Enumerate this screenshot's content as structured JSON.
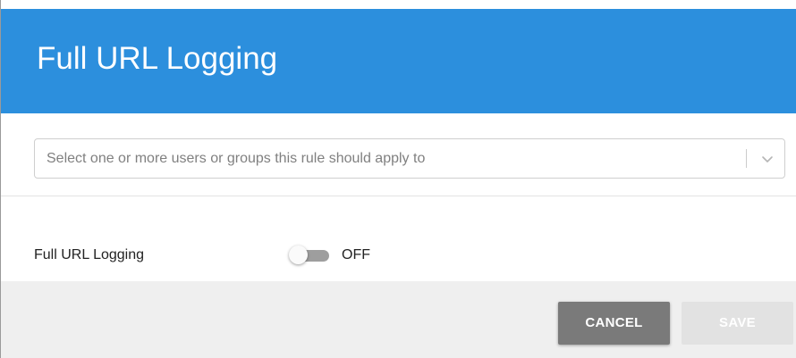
{
  "dialog": {
    "title": "Full URL Logging"
  },
  "user_select": {
    "placeholder": "Select one or more users or groups this rule should apply to",
    "arrow_icon": "chevron-down-icon"
  },
  "setting": {
    "label": "Full URL Logging",
    "toggle_state": "OFF",
    "enabled": false
  },
  "footer": {
    "cancel_label": "CANCEL",
    "save_label": "SAVE",
    "save_disabled": true
  },
  "colors": {
    "header_bg": "#2c8fdd",
    "footer_bg": "#efefef",
    "cancel_bg": "#7a7a7a",
    "save_disabled_bg": "#e2e2e2"
  }
}
